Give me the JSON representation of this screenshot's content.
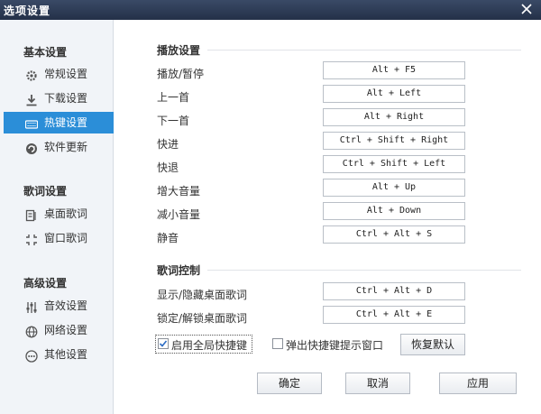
{
  "window": {
    "title": "选项设置",
    "close_icon": "close-icon"
  },
  "sidebar": {
    "groups": [
      {
        "title": "基本设置",
        "items": [
          {
            "label": "常规设置",
            "icon": "gear-icon"
          },
          {
            "label": "下载设置",
            "icon": "download-icon"
          },
          {
            "label": "热键设置",
            "icon": "keyboard-icon",
            "active": true
          },
          {
            "label": "软件更新",
            "icon": "update-icon"
          }
        ]
      },
      {
        "title": "歌词设置",
        "items": [
          {
            "label": "桌面歌词",
            "icon": "desktop-lyrics-icon"
          },
          {
            "label": "窗口歌词",
            "icon": "window-lyrics-icon"
          }
        ]
      },
      {
        "title": "高级设置",
        "items": [
          {
            "label": "音效设置",
            "icon": "equalizer-icon"
          },
          {
            "label": "网络设置",
            "icon": "network-icon"
          },
          {
            "label": "其他设置",
            "icon": "more-icon"
          }
        ]
      }
    ]
  },
  "playback": {
    "title": "播放设置",
    "rows": [
      {
        "label": "播放/暂停",
        "hotkey": "Alt + F5"
      },
      {
        "label": "上一首",
        "hotkey": "Alt + Left"
      },
      {
        "label": "下一首",
        "hotkey": "Alt + Right"
      },
      {
        "label": "快进",
        "hotkey": "Ctrl + Shift + Right"
      },
      {
        "label": "快退",
        "hotkey": "Ctrl + Shift + Left"
      },
      {
        "label": "增大音量",
        "hotkey": "Alt + Up"
      },
      {
        "label": "减小音量",
        "hotkey": "Alt + Down"
      },
      {
        "label": "静音",
        "hotkey": "Ctrl + Alt + S"
      }
    ]
  },
  "lyrics": {
    "title": "歌词控制",
    "rows": [
      {
        "label": "显示/隐藏桌面歌词",
        "hotkey": "Ctrl + Alt + D"
      },
      {
        "label": "锁定/解锁桌面歌词",
        "hotkey": "Ctrl + Alt + E"
      }
    ]
  },
  "options": {
    "enable_global": {
      "label": "启用全局快捷键",
      "checked": true
    },
    "popup_hint": {
      "label": "弹出快捷键提示窗口",
      "checked": false
    },
    "restore_label": "恢复默认"
  },
  "footer": {
    "ok_label": "确定",
    "cancel_label": "取消",
    "apply_label": "应用"
  },
  "colors": {
    "accent": "#2b8ed8",
    "titlebar": "#2c3a55",
    "sidebar_bg": "#f1f4f8"
  }
}
